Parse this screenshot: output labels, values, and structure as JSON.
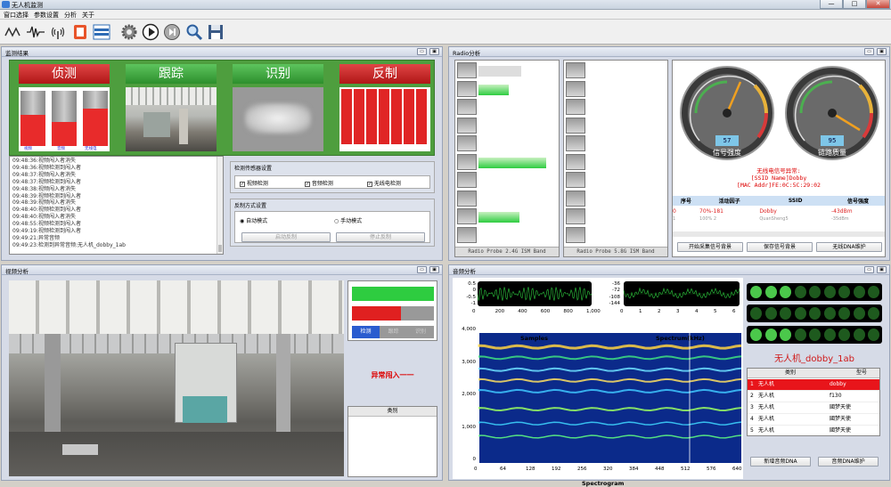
{
  "window": {
    "title": "无人机监测",
    "minimize": "—",
    "maximize": "□",
    "close": "✕"
  },
  "menu": [
    "窗口选择",
    "参数设置",
    "分析",
    "关于"
  ],
  "toolbar_icons": [
    "scan-wave-icon",
    "signal-wave-icon",
    "antenna-icon",
    "record-icon",
    "layout-icon",
    "gear-icon",
    "play-icon",
    "next-icon",
    "search-icon",
    "save-icon"
  ],
  "monitor": {
    "title": "监测结果",
    "headers": [
      "侦测",
      "跟踪",
      "识别",
      "反制"
    ],
    "bars_labels": [
      "视频",
      "音频",
      "无线电"
    ],
    "bars_levels": [
      0.57,
      0.44,
      0.68
    ],
    "counter_labels": [
      "",
      "",
      "",
      "",
      "",
      "",
      ""
    ],
    "logs": [
      "09:48:36:视频闯入者消失",
      "09:48:36:视频检测到闯入者",
      "09:48:37:视频闯入者消失",
      "09:48:37:视频检测到闯入者",
      "09:48:38:视频闯入者消失",
      "09:48:39:视频检测到闯入者",
      "09:48:39:视频闯入者消失",
      "09:48:40:视频检测到闯入者",
      "09:48:40:视频闯入者消失",
      "09:48:55:视频检测到闯入者",
      "09:49:19:视频检测到闯入者",
      "09:49:21:异常音频",
      "09:49:23:检测到异常音频:无人机_dobby_1ab"
    ],
    "sensor_title": "检测传感器设置",
    "sensors": [
      "视频检测",
      "音频检测",
      "无线电检测"
    ],
    "counter_title": "反制方式设置",
    "modes": [
      "自动模式",
      "手动模式"
    ],
    "buttons": [
      "启动反制",
      "停止反制"
    ]
  },
  "radio": {
    "title": "Radio分析",
    "band1": "Radio Probe 2.4G ISM Band",
    "band2": "Radio Probe 5.8G ISM Band",
    "band1_levels": [
      0.55,
      0.4,
      0.0,
      0.0,
      0.0,
      0.9,
      0.0,
      0.0,
      0.55,
      0.0
    ],
    "gauge1": {
      "value": "57",
      "label": "信号强度"
    },
    "gauge2": {
      "value": "95",
      "label": "链路质量"
    },
    "alert": [
      "无线电信号异常:",
      "[SSID Name]Dobby",
      "[MAC Addr]FE:0C:5C:29:02"
    ],
    "table_headers": [
      "序号",
      "活动因子",
      "SSID",
      "信号强度"
    ],
    "rows": [
      [
        "0",
        "70%-181",
        "Dobby",
        "-43dBm"
      ],
      [
        "1",
        "100% 2",
        "QuanSheng5",
        "-35dBm"
      ]
    ],
    "buttons": [
      "开始采集信号背景",
      "保存信号背景",
      "无线DNA维护"
    ]
  },
  "video": {
    "title": "视频分析",
    "side_tabs": [
      "检测",
      "跟踪",
      "识别"
    ],
    "alert": "异常闯入一一",
    "table_header": "类别",
    "levels": [
      1.0,
      0.6
    ]
  },
  "audio": {
    "title": "音频分析",
    "spectrum_label": "Spectrum(kHz)",
    "samples_label": "Samples",
    "spectrogram_label": "Spectrogram",
    "waveform_yticks": [
      "0.5",
      "0",
      "-0.5",
      "-1"
    ],
    "waveform_xticks": [
      "0",
      "200",
      "400",
      "600",
      "800",
      "1,000"
    ],
    "spectrum_yticks": [
      "-36",
      "-72",
      "-108",
      "-144"
    ],
    "spectrum_xticks": [
      "0",
      "1",
      "2",
      "3",
      "4",
      "5",
      "6"
    ],
    "spectrogram_yticks": [
      "4,000",
      "3,000",
      "2,000",
      "1,000",
      "0"
    ],
    "spectrogram_xticks": [
      "0",
      "64",
      "128",
      "192",
      "256",
      "320",
      "384",
      "448",
      "512",
      "576",
      "640"
    ],
    "drone_name": "无人机_dobby_1ab",
    "table_headers": [
      "类别",
      "型号"
    ],
    "rows": [
      [
        "1",
        "无人机",
        "dobby"
      ],
      [
        "2",
        "无人机",
        "f130"
      ],
      [
        "3",
        "无人机",
        "國梦天使"
      ],
      [
        "4",
        "无人机",
        "國梦天使"
      ],
      [
        "5",
        "无人机",
        "國梦天使"
      ]
    ],
    "buttons": [
      "新增音频DNA",
      "音频DNA维护"
    ]
  }
}
